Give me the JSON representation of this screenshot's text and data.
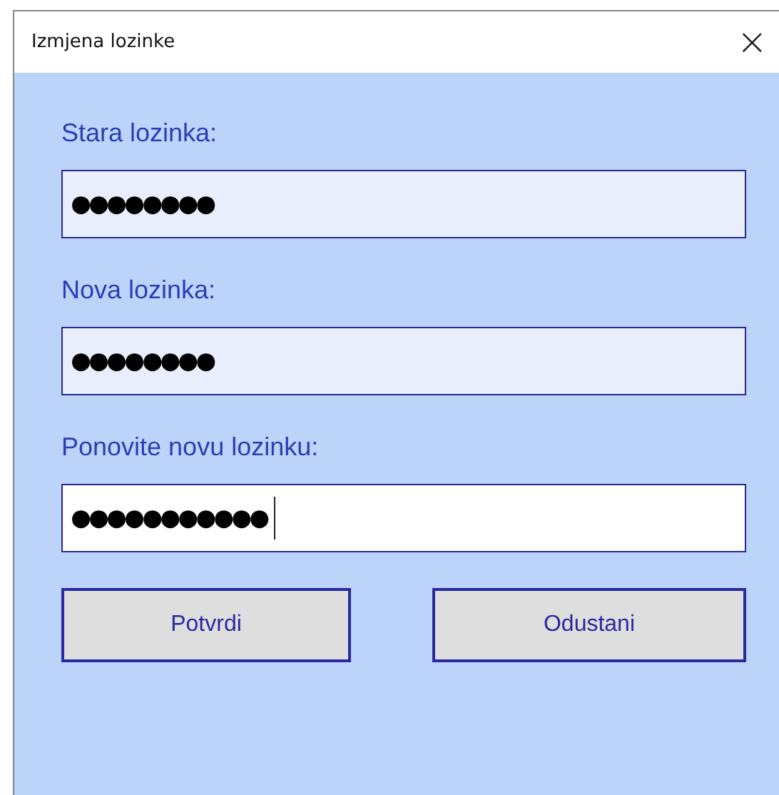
{
  "window": {
    "title": "Izmjena lozinke",
    "close": "×"
  },
  "fields": [
    {
      "label": "Stara lozinka:",
      "value": "●●●●●●●●",
      "focused": false
    },
    {
      "label": "Nova lozinka:",
      "value": "●●●●●●●●",
      "focused": false
    },
    {
      "label": "Ponovite novu lozinku:",
      "value": "●●●●●●●●●●●",
      "focused": true
    }
  ],
  "buttons": [
    "Potvrdi",
    "Odustani"
  ]
}
